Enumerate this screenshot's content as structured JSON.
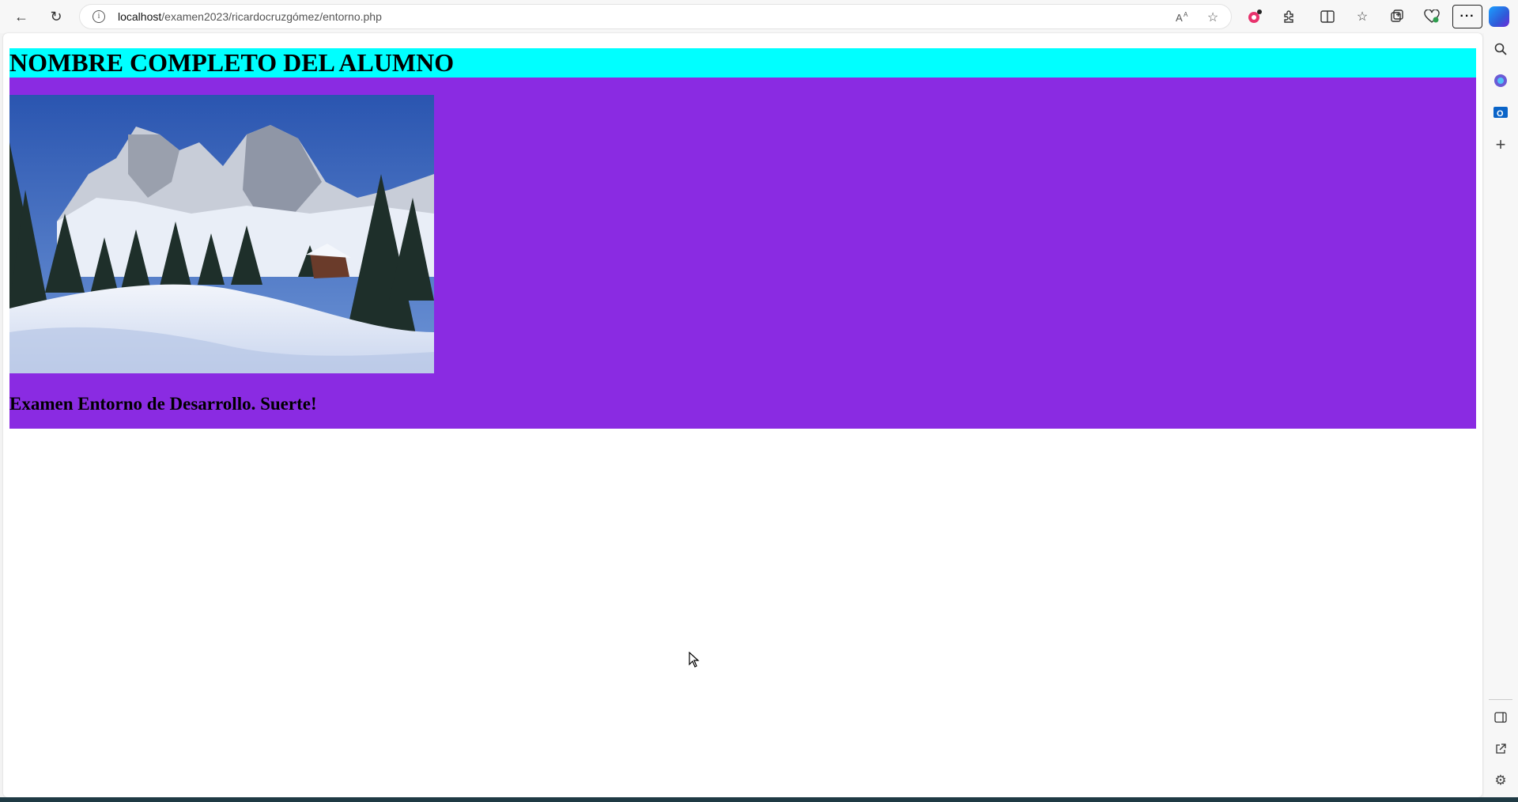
{
  "browser": {
    "url_host": "localhost",
    "url_path": "/examen2023/ricardocruzgómez/entorno.php",
    "toolbar_icons": [
      "back-icon",
      "refresh-icon"
    ],
    "address_icons": [
      "info-icon",
      "read-aloud-icon",
      "favorite-star-icon"
    ],
    "extension_icons": [
      "extension-badge-icon",
      "extensions-puzzle-icon",
      "split-screen-icon",
      "favorites-icon",
      "collections-icon",
      "browser-essentials-icon"
    ],
    "more_label": "···",
    "sidebar_icons": [
      "search-icon",
      "copilot-apps-icon",
      "outlook-icon",
      "add-icon",
      "sidebar-toggle-icon",
      "open-external-icon",
      "settings-icon"
    ]
  },
  "page": {
    "title": "NOMBRE COMPLETO DEL ALUMNO",
    "subtitle": "Examen Entorno de Desarrollo. Suerte!",
    "header_bg": "#00ffff",
    "content_bg": "#8a2be2",
    "image": "snowy-mountain-landscape"
  }
}
